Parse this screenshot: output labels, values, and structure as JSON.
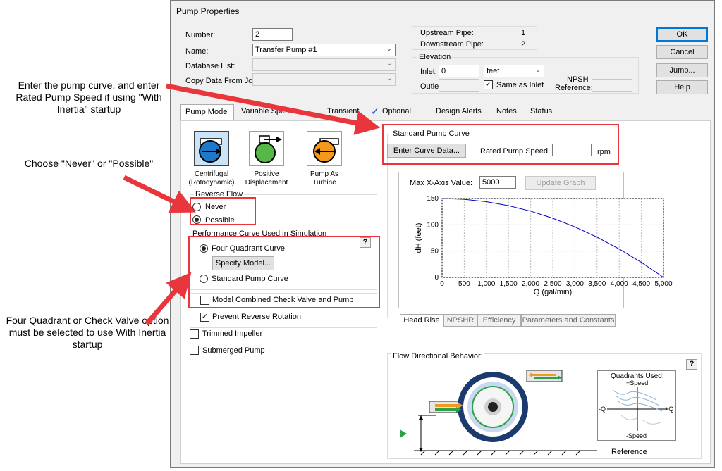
{
  "callouts": {
    "curve": "Enter the pump curve, and enter Rated Pump Speed if using \"With Inertia\" startup",
    "reverse": "Choose \"Never\" or \"Possible\"",
    "quadrant": "Four Quadrant or Check Valve option must be selected to use With Inertia startup"
  },
  "dialog": {
    "title": "Pump Properties",
    "number_label": "Number:",
    "number_value": "2",
    "name_label": "Name:",
    "name_value": "Transfer Pump #1",
    "database_label": "Database List:",
    "copy_label": "Copy Data From Jct...",
    "upstream_label": "Upstream Pipe:",
    "upstream_value": "1",
    "downstream_label": "Downstream Pipe:",
    "downstream_value": "2",
    "elevation_label": "Elevation",
    "inlet_label": "Inlet:",
    "inlet_value": "0",
    "unit_value": "feet",
    "outlet_label": "Outlet:",
    "same_as_inlet": "Same as Inlet",
    "npsh_label_1": "NPSH",
    "npsh_label_2": "Reference:",
    "ok": "OK",
    "cancel": "Cancel",
    "jump": "Jump...",
    "help": "Help"
  },
  "tabs": [
    "Pump Model",
    "Variable Speed",
    "Transient",
    "Optional",
    "Design Alerts",
    "Notes",
    "Status"
  ],
  "pump_model": {
    "types": [
      {
        "line1": "Centrifugal",
        "line2": "(Rotodynamic)"
      },
      {
        "line1": "Positive",
        "line2": "Displacement"
      },
      {
        "line1": "Pump As",
        "line2": "Turbine"
      }
    ],
    "reverse_flow_label": "Reverse Flow",
    "never": "Never",
    "possible": "Possible",
    "perf_curve_label": "Performance Curve Used in Simulation",
    "four_quadrant": "Four Quadrant Curve",
    "specify_model": "Specify Model...",
    "standard_curve": "Standard Pump Curve",
    "model_combined": "Model Combined Check Valve and Pump",
    "prevent_reverse": "Prevent Reverse Rotation",
    "trimmed": "Trimmed Impeller",
    "submerged": "Submerged Pump",
    "help_q": "?"
  },
  "standard_curve": {
    "label": "Standard Pump Curve",
    "enter_curve": "Enter Curve Data...",
    "rated_speed_label": "Rated Pump Speed:",
    "rated_speed_value": "",
    "rpm": "rpm",
    "max_x_label": "Max X-Axis Value:",
    "max_x_value": "5000",
    "update_graph": "Update Graph"
  },
  "graph_tabs": [
    "Head Rise",
    "NPSHR",
    "Efficiency",
    "Parameters and Constants"
  ],
  "chart_data": {
    "type": "line",
    "xlabel": "Q (gal/min)",
    "ylabel": "dH (feet)",
    "xlim": [
      0,
      5000
    ],
    "ylim": [
      0,
      150
    ],
    "xticks": [
      "0",
      "500",
      "1,000",
      "1,500",
      "2,000",
      "2,500",
      "3,000",
      "3,500",
      "4,000",
      "4,500",
      "5,000"
    ],
    "yticks": [
      "0",
      "50",
      "100",
      "150"
    ],
    "series": [
      {
        "x": [
          0,
          500,
          1000,
          1500,
          2000,
          2500,
          3000,
          3500,
          4000,
          4500,
          5000
        ],
        "y": [
          150,
          148.5,
          144,
          136.5,
          126,
          112.5,
          96,
          76.5,
          54,
          28.5,
          0
        ]
      }
    ],
    "color": "#0000cc",
    "grid": true
  },
  "flow": {
    "label": "Flow Directional Behavior:",
    "help_q": "?",
    "quadrants_label": "Quadrants Used:",
    "plus_speed": "+Speed",
    "minus_speed": "-Speed",
    "minus_q": "-Q",
    "plus_q": "+Q",
    "reference": "Reference"
  },
  "colors": {
    "callout_red": "#e8363c",
    "accent_blue": "#0078d7"
  }
}
